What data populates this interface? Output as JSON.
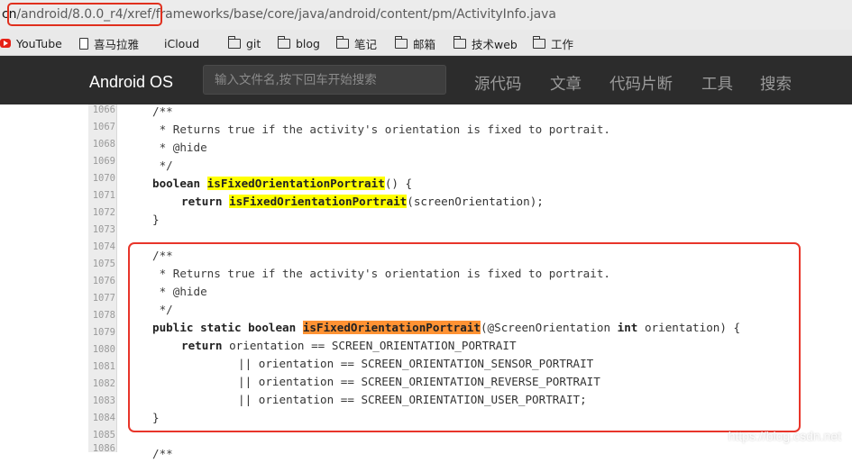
{
  "browser": {
    "url_host": "cn",
    "url_path": "/android/8.0.0_r4/xref/frameworks/base/core/java/android/content/pm/ActivityInfo.java",
    "bookmarks": [
      {
        "label": "YouTube",
        "icon": "youtube-icon"
      },
      {
        "label": "喜马拉雅",
        "icon": "document-icon"
      },
      {
        "label": "iCloud",
        "icon": "apple-icon"
      },
      {
        "label": "git",
        "icon": "folder-icon"
      },
      {
        "label": "blog",
        "icon": "folder-icon"
      },
      {
        "label": "笔记",
        "icon": "folder-icon"
      },
      {
        "label": "邮箱",
        "icon": "folder-icon"
      },
      {
        "label": "技术web",
        "icon": "folder-icon"
      },
      {
        "label": "工作",
        "icon": "folder-icon"
      }
    ]
  },
  "site": {
    "brand": "Android OS",
    "search_placeholder": "输入文件名,按下回车开始搜索",
    "nav": [
      "源代码",
      "文章",
      "代码片断",
      "工具",
      "搜索"
    ]
  },
  "code": {
    "line_numbers": [
      "1066",
      "1067",
      "1068",
      "1069",
      "1070",
      "1071",
      "1072",
      "1073",
      "1074",
      "1075",
      "1076",
      "1077",
      "1078",
      "1079",
      "1080",
      "1081",
      "1082",
      "1083",
      "1084",
      "1085",
      "1086"
    ],
    "lines": {
      "l1066": "/**",
      "l1067": " * Returns true if the activity's orientation is fixed to portrait.",
      "l1068": " * @hide",
      "l1069": " */",
      "l1070_kw": "boolean",
      "l1070_ident": "isFixedOrientationPortrait",
      "l1070_rest": "() {",
      "l1071_kw": "return",
      "l1071_ident": "isFixedOrientationPortrait",
      "l1071_rest": "(screenOrientation);",
      "l1072": "}",
      "l1074": "/**",
      "l1075": " * Returns true if the activity's orientation is fixed to portrait.",
      "l1076": " * @hide",
      "l1077": " */",
      "l1078_kw": "public static boolean",
      "l1078_ident": "isFixedOrientationPortrait",
      "l1078_mid": "(@ScreenOrientation ",
      "l1078_kw2": "int",
      "l1078_rest": " orientation) {",
      "l1079_kw": "return",
      "l1079_rest": " orientation == SCREEN_ORIENTATION_PORTRAIT",
      "l1080": "|| orientation == SCREEN_ORIENTATION_SENSOR_PORTRAIT",
      "l1081": "|| orientation == SCREEN_ORIENTATION_REVERSE_PORTRAIT",
      "l1082": "|| orientation == SCREEN_ORIENTATION_USER_PORTRAIT;",
      "l1083": "}",
      "l1085": "/**"
    }
  },
  "watermark": "https://blog.csdn.net",
  "colors": {
    "highlight_yellow": "#ffff00",
    "highlight_orange": "#ff9233",
    "annotation_red": "#e8352a",
    "nav_bg": "#2c2c2c"
  }
}
